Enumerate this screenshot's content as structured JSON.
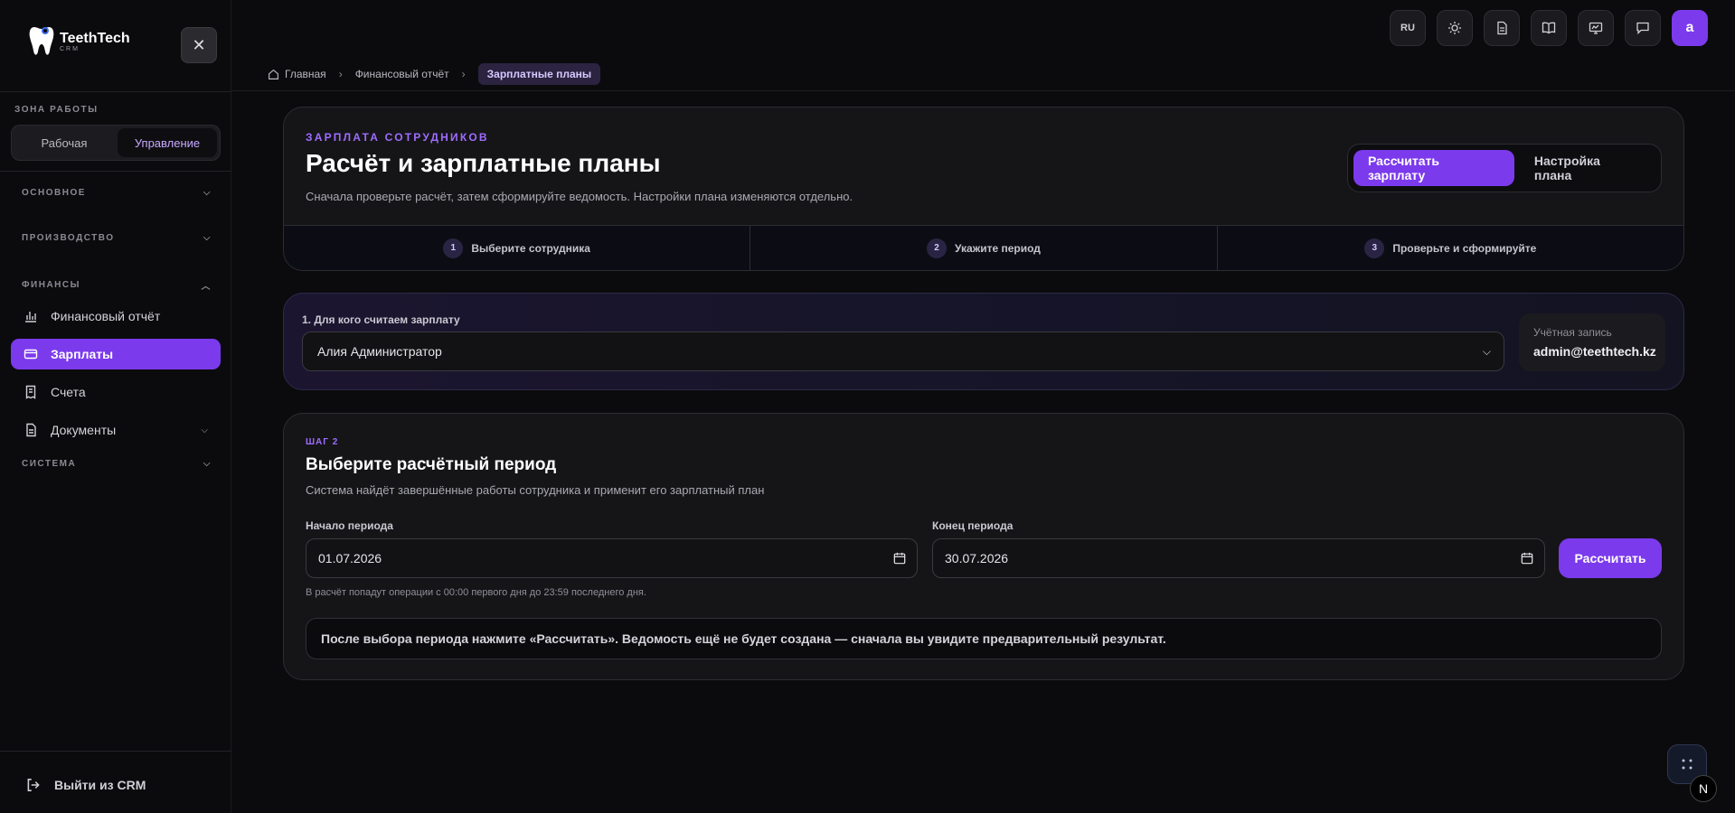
{
  "brand": {
    "name": "TeethTech",
    "sub": "CRM"
  },
  "sidebar": {
    "zone_label": "ЗОНА РАБОТЫ",
    "zone_options": [
      "Рабочая",
      "Управление"
    ],
    "zone_active": "Управление",
    "sections": {
      "main": "ОСНОВНОЕ",
      "production": "ПРОИЗВОДСТВО",
      "finance": "ФИНАНСЫ",
      "system": "СИСТЕМА"
    },
    "items": [
      {
        "label": "Финансовый отчёт",
        "icon": "chart-icon"
      },
      {
        "label": "Зарплаты",
        "icon": "wallet-icon",
        "active": true
      },
      {
        "label": "Счета",
        "icon": "receipt-icon"
      },
      {
        "label": "Документы",
        "icon": "document-icon"
      }
    ],
    "logout": "Выйти из CRM"
  },
  "topbar": {
    "lang": "RU",
    "icons": [
      "sun-icon",
      "file-icon",
      "book-icon",
      "monitor-icon",
      "chat-icon"
    ],
    "avatar": "a"
  },
  "breadcrumb": {
    "home": "Главная",
    "parent": "Финансовый отчёт",
    "current": "Зарплатные планы"
  },
  "header_card": {
    "eyebrow": "ЗАРПЛАТА СОТРУДНИКОВ",
    "title": "Расчёт и зарплатные планы",
    "subtitle": "Сначала проверьте расчёт, затем сформируйте ведомость. Настройки плана изменяются отдельно.",
    "tab_active": "Рассчитать зарплату",
    "tab_other": "Настройка плана",
    "steps": [
      {
        "num": "1",
        "label": "Выберите сотрудника"
      },
      {
        "num": "2",
        "label": "Укажите период"
      },
      {
        "num": "3",
        "label": "Проверьте и сформируйте"
      }
    ]
  },
  "employee_card": {
    "label": "1. Для кого считаем зарплату",
    "selected": "Алия Администратор",
    "account_label": "Учётная запись",
    "account_value": "admin@teethtech.kz"
  },
  "period_card": {
    "step": "ШАГ 2",
    "title": "Выберите расчётный период",
    "subtitle": "Система найдёт завершённые работы сотрудника и применит его зарплатный план",
    "start_label": "Начало периода",
    "start_value": "01.07.2026",
    "end_label": "Конец периода",
    "end_value": "30.07.2026",
    "calc_button": "Рассчитать",
    "hint": "В расчёт попадут операции с 00:00 первого дня до 23:59 последнего дня.",
    "notice": "После выбора периода нажмите «Рассчитать». Ведомость ещё не будет создана — сначала вы увидите предварительный результат."
  },
  "colors": {
    "accent": "#7c3aed",
    "background": "#0b0b0d",
    "card": "#151518"
  }
}
